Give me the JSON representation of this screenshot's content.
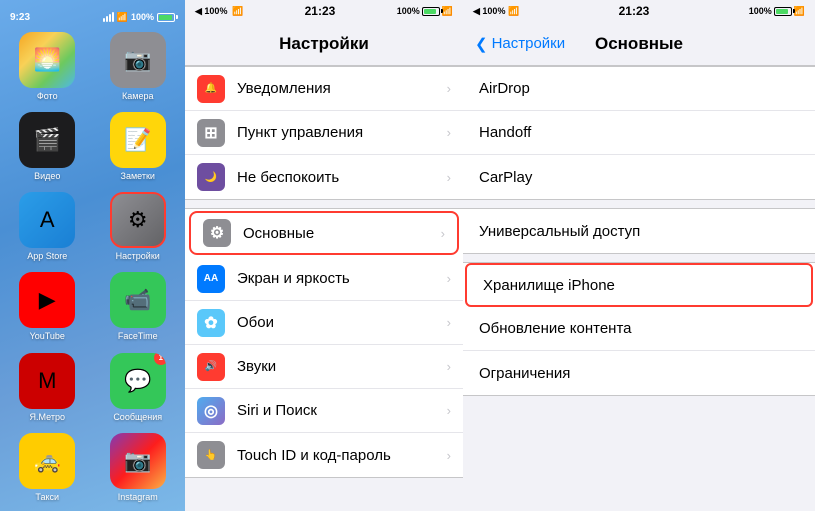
{
  "left_panel": {
    "status_time": "9:23",
    "signal": "100%",
    "apps": [
      {
        "id": "photos",
        "label": "Фото",
        "icon_class": "icon-photos",
        "symbol": "🌅"
      },
      {
        "id": "camera",
        "label": "Камера",
        "icon_class": "icon-camera",
        "symbol": "📷"
      },
      {
        "id": "video",
        "label": "Видео",
        "icon_class": "icon-video",
        "symbol": "🎬"
      },
      {
        "id": "notes",
        "label": "Заметки",
        "icon_class": "icon-notes",
        "symbol": "📝"
      },
      {
        "id": "appstore",
        "label": "App Store",
        "icon_class": "icon-appstore",
        "symbol": "A"
      },
      {
        "id": "settings",
        "label": "Настройки",
        "icon_class": "icon-settings",
        "symbol": "⚙",
        "highlighted": true
      },
      {
        "id": "youtube",
        "label": "YouTube",
        "icon_class": "icon-youtube",
        "symbol": "▶"
      },
      {
        "id": "facetime",
        "label": "FaceTime",
        "icon_class": "icon-facetime",
        "symbol": "📹"
      },
      {
        "id": "metro",
        "label": "Я.Метро",
        "icon_class": "icon-metro",
        "symbol": "М"
      },
      {
        "id": "messages",
        "label": "Сообщения",
        "icon_class": "icon-messages",
        "symbol": "💬",
        "badge": "1"
      },
      {
        "id": "taxi",
        "label": "Такси",
        "icon_class": "icon-taxi",
        "symbol": "🚕"
      },
      {
        "id": "instagram",
        "label": "Instagram",
        "icon_class": "icon-instagram",
        "symbol": "📷"
      }
    ]
  },
  "middle_panel": {
    "status_time": "21:23",
    "title": "Настройки",
    "sections": [
      {
        "items": [
          {
            "id": "notifications",
            "label": "Уведомления",
            "icon_class": "icon-notif",
            "symbol": "🔔"
          },
          {
            "id": "control",
            "label": "Пункт управления",
            "icon_class": "icon-control",
            "symbol": "⊞"
          },
          {
            "id": "dnd",
            "label": "Не беспокоить",
            "icon_class": "icon-dnd",
            "symbol": "🌙"
          }
        ]
      },
      {
        "items": [
          {
            "id": "general",
            "label": "Основные",
            "icon_class": "icon-general",
            "symbol": "⚙",
            "highlighted": true
          },
          {
            "id": "display",
            "label": "Экран и яркость",
            "icon_class": "icon-display",
            "symbol": "AA"
          },
          {
            "id": "wallpaper",
            "label": "Обои",
            "icon_class": "icon-wallpaper",
            "symbol": "✿"
          },
          {
            "id": "sounds",
            "label": "Звуки",
            "icon_class": "icon-sound",
            "symbol": "🔊"
          },
          {
            "id": "siri",
            "label": "Siri и Поиск",
            "icon_class": "icon-siri",
            "symbol": "◎"
          },
          {
            "id": "touch",
            "label": "Touch ID и код-пароль",
            "icon_class": "icon-touch",
            "symbol": "👆"
          }
        ]
      }
    ]
  },
  "right_panel": {
    "status_time": "21:23",
    "back_label": "Настройки",
    "title": "Основные",
    "items": [
      {
        "id": "airdrop",
        "label": "AirDrop"
      },
      {
        "id": "handoff",
        "label": "Handoff"
      },
      {
        "id": "carplay",
        "label": "CarPlay"
      },
      {
        "id": "accessibility",
        "label": "Универсальный доступ"
      },
      {
        "id": "storage",
        "label": "Хранилище iPhone",
        "highlighted": true
      },
      {
        "id": "content_update",
        "label": "Обновление контента"
      },
      {
        "id": "restrictions",
        "label": "Ограничения"
      }
    ]
  }
}
